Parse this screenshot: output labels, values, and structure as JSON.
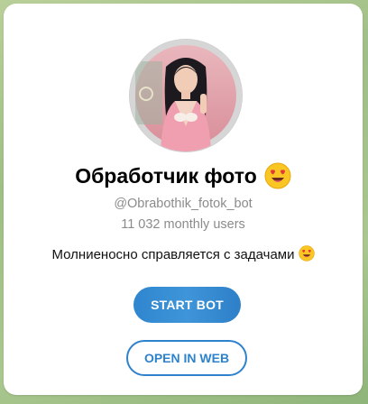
{
  "bot": {
    "name": "Обработчик фото",
    "username": "@Obrabothik_fotok_bot",
    "monthly_users": "11 032 monthly users",
    "description": "Молниеносно справляется с задачами"
  },
  "buttons": {
    "start_label": "START BOT",
    "web_label": "OPEN IN WEB"
  },
  "icons": {
    "title_emoji": "heart-eyes-emoji-icon",
    "description_emoji": "heart-eyes-emoji-icon"
  },
  "colors": {
    "accent": "#2e82cc",
    "background": "#a9c78e",
    "card": "#ffffff",
    "secondary_text": "#8b8b8b"
  }
}
